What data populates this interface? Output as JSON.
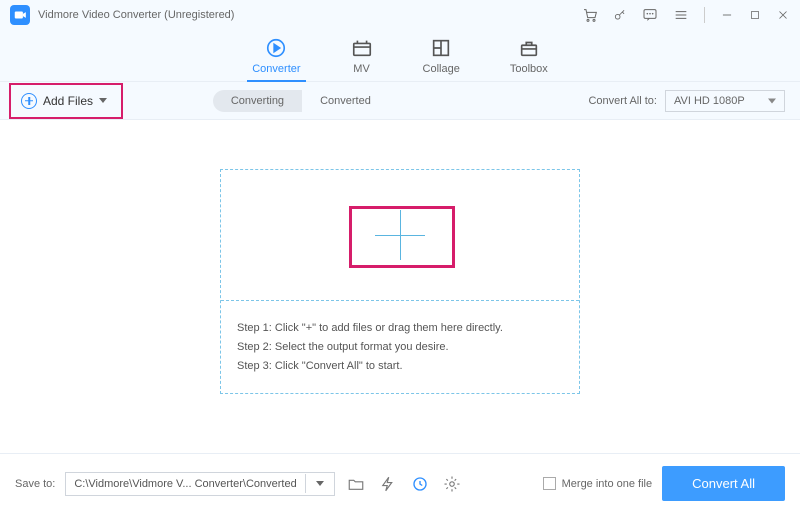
{
  "title": "Vidmore Video Converter (Unregistered)",
  "tabs": {
    "converter": "Converter",
    "mv": "MV",
    "collage": "Collage",
    "toolbox": "Toolbox"
  },
  "toolbar": {
    "add_files": "Add Files",
    "converting": "Converting",
    "converted": "Converted",
    "convert_all_to": "Convert All to:",
    "format": "AVI HD 1080P"
  },
  "steps": {
    "s1": "Step 1: Click \"+\" to add files or drag them here directly.",
    "s2": "Step 2: Select the output format you desire.",
    "s3": "Step 3: Click \"Convert All\" to start."
  },
  "footer": {
    "save_to": "Save to:",
    "path": "C:\\Vidmore\\Vidmore V... Converter\\Converted",
    "merge": "Merge into one file",
    "convert_all": "Convert All"
  }
}
